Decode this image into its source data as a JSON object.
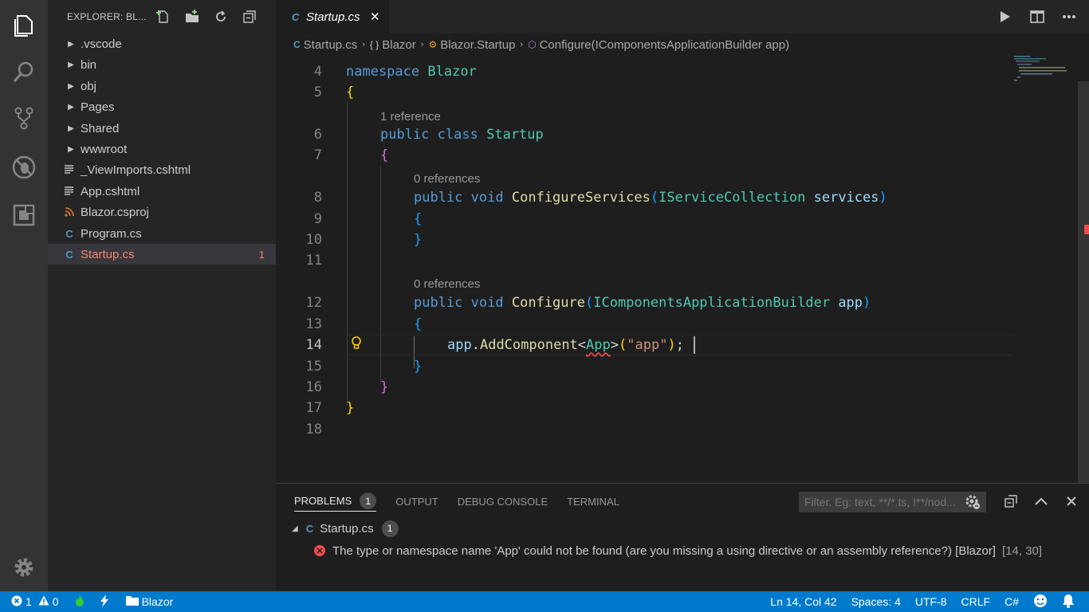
{
  "activity_bar": {
    "items": [
      "explorer-icon",
      "search-icon",
      "source-control-icon",
      "debug-icon",
      "extensions-icon"
    ],
    "settings": "gear-icon"
  },
  "sidebar": {
    "title": "EXPLORER: BL...",
    "items": [
      {
        "label": ".vscode",
        "type": "folder"
      },
      {
        "label": "bin",
        "type": "folder"
      },
      {
        "label": "obj",
        "type": "folder"
      },
      {
        "label": "Pages",
        "type": "folder"
      },
      {
        "label": "Shared",
        "type": "folder"
      },
      {
        "label": "wwwroot",
        "type": "folder"
      },
      {
        "label": "_ViewImports.cshtml",
        "type": "cshtml"
      },
      {
        "label": "App.cshtml",
        "type": "cshtml"
      },
      {
        "label": "Blazor.csproj",
        "type": "csproj"
      },
      {
        "label": "Program.cs",
        "type": "cs"
      },
      {
        "label": "Startup.cs",
        "type": "cs",
        "selected": true,
        "badge": "1"
      }
    ]
  },
  "tab": {
    "icon_letter": "C",
    "label": "Startup.cs",
    "close": "✕"
  },
  "breadcrumb": {
    "items": [
      "Startup.cs",
      "Blazor",
      "Blazor.Startup",
      "Configure(IComponentsApplicationBuilder app)"
    ],
    "icons": [
      "C",
      "{ }",
      "⚙",
      "⬡"
    ]
  },
  "editor": {
    "active_line": "14",
    "lines": [
      "4",
      "5",
      "6",
      "7",
      "8",
      "9",
      "10",
      "11",
      "12",
      "13",
      "14",
      "15",
      "16",
      "17",
      "18"
    ],
    "code_lens": [
      "1 reference",
      "0 references",
      "0 references"
    ],
    "code": {
      "l4_kw": "namespace",
      "l4_name": "Blazor",
      "brace_open": "{",
      "brace_close": "}",
      "l6_public": "public",
      "l6_class": "class",
      "l6_name": "Startup",
      "l8_public": "public",
      "l8_void": "void",
      "l8_fn": "ConfigureServices",
      "l8_type": "IServiceCollection",
      "l8_param": "services",
      "l12_public": "public",
      "l12_void": "void",
      "l12_fn": "Configure",
      "l12_type": "IComponentsApplicationBuilder",
      "l12_param": "app",
      "l14_obj": "app",
      "l14_fn": "AddComponent",
      "l14_type": "App",
      "l14_str": "\"app\"",
      "paren_open": "(",
      "paren_close": ")",
      "lt": "<",
      "gt": ">",
      "dot": ".",
      "semi": ";"
    }
  },
  "panel": {
    "tabs": [
      "PROBLEMS",
      "OUTPUT",
      "DEBUG CONSOLE",
      "TERMINAL"
    ],
    "problems_count": "1",
    "filter_placeholder": "Filter. Eg: text, **/*.ts, !**/nod...",
    "file": "Startup.cs",
    "file_count": "1",
    "error_message": "The type or namespace name 'App' could not be found (are you missing a using directive or an assembly reference?) [Blazor]",
    "error_location": "[14, 30]"
  },
  "status_bar": {
    "errors": "1",
    "warnings": "0",
    "folder": "Blazor",
    "position": "Ln 14, Col 42",
    "spaces": "Spaces: 4",
    "encoding": "UTF-8",
    "eol": "CRLF",
    "language": "C#"
  },
  "colors": {
    "status_bar": "#007acc",
    "activity_bar": "#333333",
    "sidebar": "#252526",
    "editor": "#1e1e1e",
    "error": "#f14c4c"
  }
}
